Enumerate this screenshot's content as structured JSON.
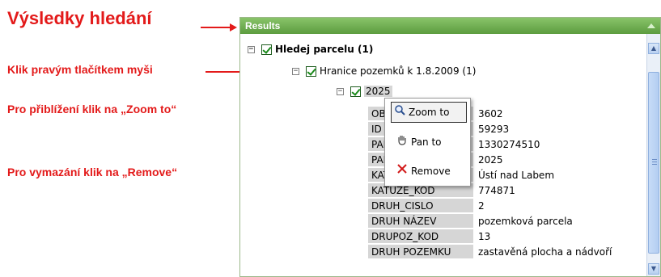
{
  "annotations": {
    "title": "Výsledky hledání",
    "right_click": "Klik pravým tlačítkem myši",
    "zoom": "Pro přiblížení klik na „Zoom to“",
    "remove": "Pro vymazání klik na „Remove“",
    "color": "#e31a1a"
  },
  "panel": {
    "title": "Results",
    "header_color": "#6aaa4b"
  },
  "tree": {
    "root": "Hledej parcelu (1)",
    "layer": "Hranice pozemků k 1.8.2009 (1)",
    "feature": "2025"
  },
  "context_menu": {
    "zoom": "Zoom to",
    "pan": "Pan to",
    "remove": "Remove",
    "icons": [
      "magnifier-icon",
      "hand-icon",
      "red-x-icon"
    ]
  },
  "attributes": [
    {
      "key": "OBJECTID",
      "value": "3602"
    },
    {
      "key": "ID",
      "value": "59293"
    },
    {
      "key": "PARCELA_ID",
      "value": "1330274510"
    },
    {
      "key": "PARCIS",
      "value": "2025"
    },
    {
      "key": "KATUZE_NAZEV",
      "value": "Ústí nad Labem"
    },
    {
      "key": "KATUZE_KOD",
      "value": "774871"
    },
    {
      "key": "DRUH_CISLO",
      "value": "2"
    },
    {
      "key": "DRUH NÁZEV",
      "value": "pozemková parcela"
    },
    {
      "key": "DRUPOZ_KOD",
      "value": "13"
    },
    {
      "key": "DRUH POZEMKU",
      "value": "zastavěná plocha a nádvoří"
    }
  ]
}
